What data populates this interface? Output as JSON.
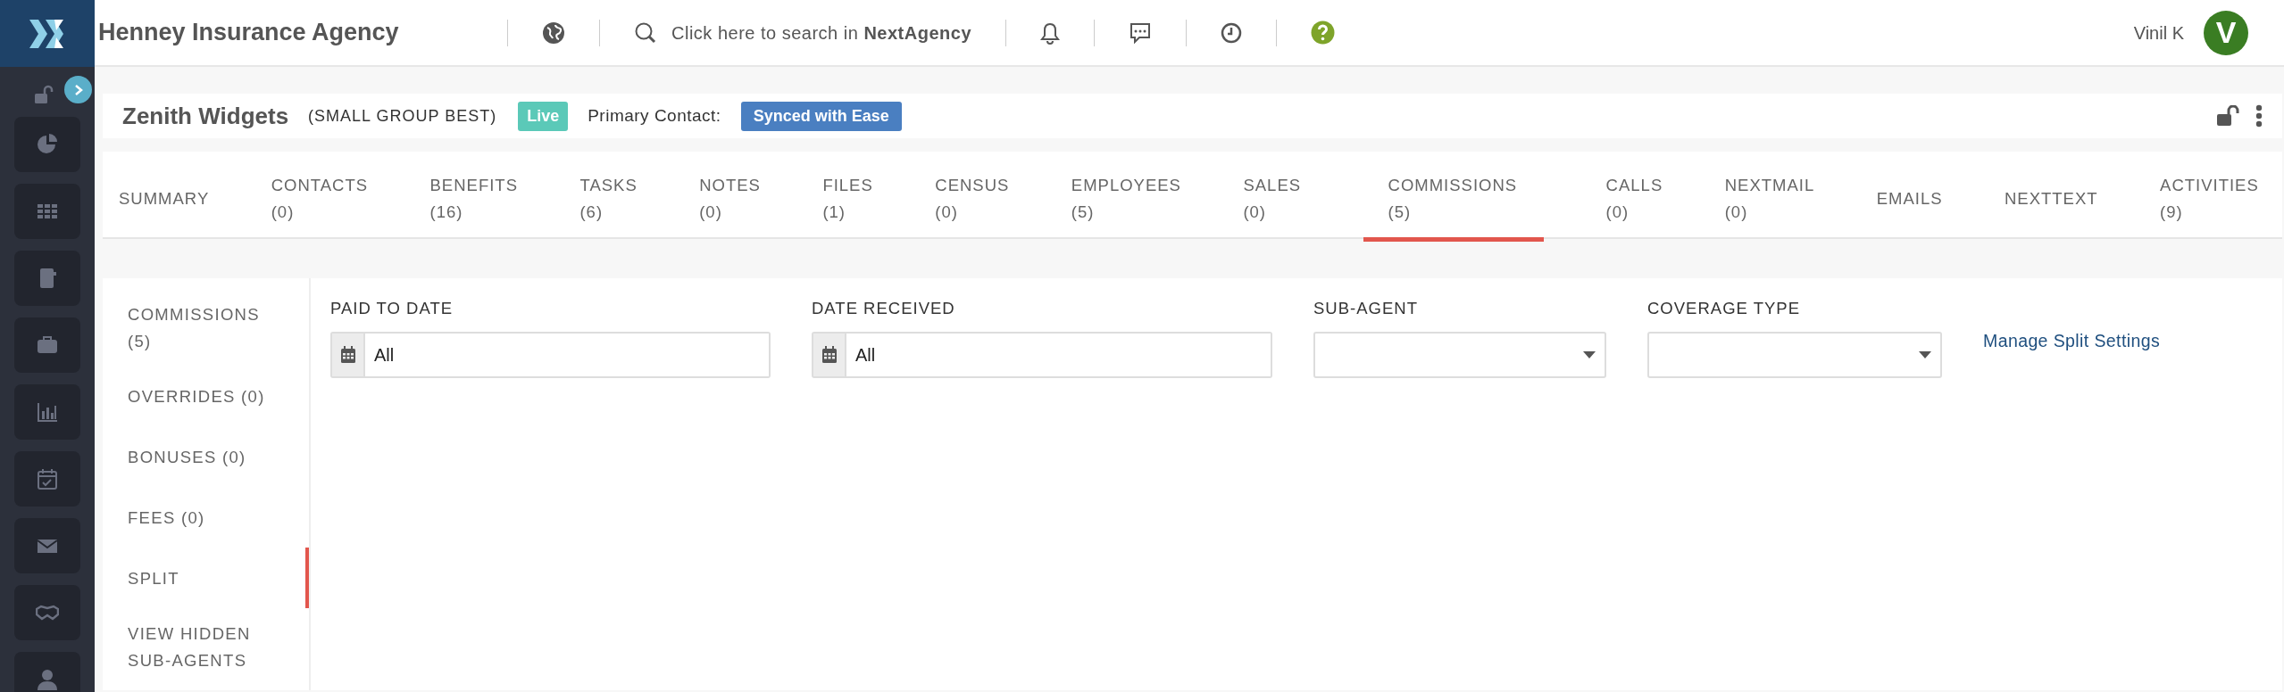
{
  "app": {
    "title": "Henney Insurance Agency",
    "search": "Click here to search in **NextAgency**",
    "user_name": "Vinil K",
    "avatar_letter": "V"
  },
  "record": {
    "name": "Zenith Widgets",
    "plan": "(SMALL GROUP BEST)",
    "status": "Live",
    "primary_contact_label": "Primary Contact:",
    "primary_contact": "Synced with Ease"
  },
  "tabs": [
    {
      "label": "SUMMARY",
      "selected": false
    },
    {
      "label": "CONTACTS",
      "count": "(0)",
      "selected": false
    },
    {
      "label": "BENEFITS",
      "count": "(16)",
      "selected": false
    },
    {
      "label": "TASKS",
      "count": "(6)",
      "selected": false
    },
    {
      "label": "NOTES",
      "count": "(0)",
      "selected": false
    },
    {
      "label": "FILES",
      "count": "(1)",
      "selected": false
    },
    {
      "label": "CENSUS",
      "count": "(0)",
      "selected": false
    },
    {
      "label": "EMPLOYEES",
      "count": "(5)",
      "selected": false
    },
    {
      "label": "SALES",
      "count": "(0)",
      "selected": false
    },
    {
      "label": "COMMISSIONS",
      "count": "(5)",
      "selected": true
    },
    {
      "label": "CALLS",
      "count": "(0)",
      "selected": false
    },
    {
      "label": "NEXTMAIL",
      "count": "(0)",
      "selected": false
    },
    {
      "label": "EMAILS",
      "selected": false
    },
    {
      "label": "NEXTTEXT",
      "selected": false
    },
    {
      "label": "ACTIVITIES",
      "count": "(9)",
      "selected": false
    }
  ],
  "subnav": [
    {
      "label": "COMMISSIONS (5)",
      "selected": false
    },
    {
      "label": "OVERRIDES (0)",
      "selected": false
    },
    {
      "label": "BONUSES (0)",
      "selected": false
    },
    {
      "label": "FEES (0)",
      "selected": false
    },
    {
      "label": "SPLIT",
      "selected": true
    },
    {
      "label": "VIEW HIDDEN SUB-AGENTS",
      "selected": false
    }
  ],
  "filters": [
    {
      "kind": "date",
      "label": "PAID TO DATE",
      "value": "All"
    },
    {
      "kind": "date",
      "label": "DATE RECEIVED",
      "value": "All"
    },
    {
      "kind": "select",
      "label": "SUB-AGENT"
    },
    {
      "kind": "select",
      "label": "COVERAGE TYPE"
    }
  ],
  "link": "Manage Split Settings"
}
